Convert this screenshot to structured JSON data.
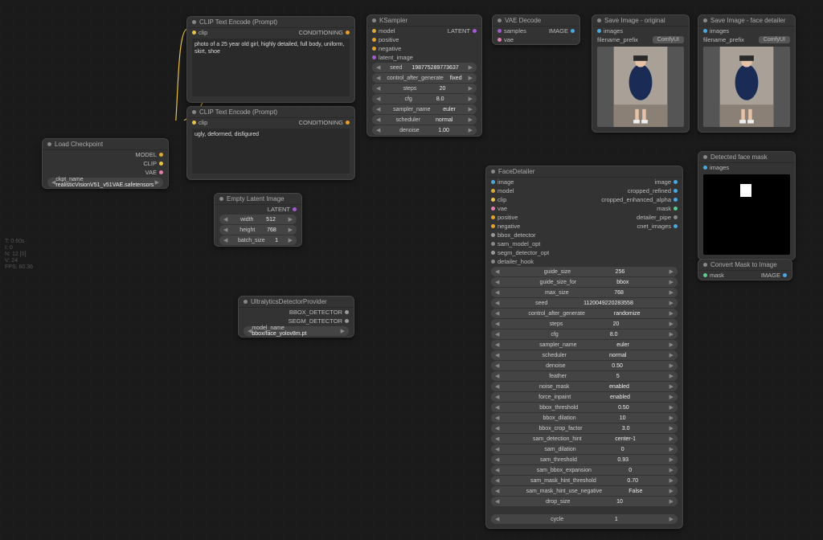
{
  "stats": {
    "l1": "T: 0.60s",
    "l2": "I: 0",
    "l3": "N: 12 [0]",
    "l4": "V: 24",
    "l5": "FPS: 60.36"
  },
  "load_ckpt": {
    "title": "Load Checkpoint",
    "out_model": "MODEL",
    "out_clip": "CLIP",
    "out_vae": "VAE",
    "ckpt_label": "ckpt_name",
    "ckpt_value": "realisticVisionV51_v51VAE.safetensors"
  },
  "clip_pos": {
    "title": "CLIP Text Encode (Prompt)",
    "in_clip": "clip",
    "out_cond": "CONDITIONING",
    "text": "photo of a 25 year old girl, highly detailed, full body, uniform, skirt, shoe"
  },
  "clip_neg": {
    "title": "CLIP Text Encode (Prompt)",
    "in_clip": "clip",
    "out_cond": "CONDITIONING",
    "text": "ugly, deformed, disfigured"
  },
  "empty": {
    "title": "Empty Latent Image",
    "out": "LATENT",
    "rows": [
      {
        "k": "width",
        "v": "512"
      },
      {
        "k": "height",
        "v": "768"
      },
      {
        "k": "batch_size",
        "v": "1"
      }
    ]
  },
  "ksampler": {
    "title": "KSampler",
    "ins": [
      "model",
      "positive",
      "negative",
      "latent_image"
    ],
    "out": "LATENT",
    "rows": [
      {
        "k": "seed",
        "v": "198775289773637"
      },
      {
        "k": "control_after_generate",
        "v": "fixed"
      },
      {
        "k": "steps",
        "v": "20"
      },
      {
        "k": "cfg",
        "v": "8.0"
      },
      {
        "k": "sampler_name",
        "v": "euler"
      },
      {
        "k": "scheduler",
        "v": "normal"
      },
      {
        "k": "denoise",
        "v": "1.00"
      }
    ]
  },
  "vae_dec": {
    "title": "VAE Decode",
    "in_samples": "samples",
    "in_vae": "vae",
    "out": "IMAGE"
  },
  "save_orig": {
    "title": "Save Image - original",
    "in": "images",
    "prefix_label": "filename_prefix",
    "prefix": "ComfyUI"
  },
  "save_face": {
    "title": "Save Image - face detailer",
    "in": "images",
    "prefix_label": "filename_prefix",
    "prefix": "ComfyUI"
  },
  "det_mask": {
    "title": "Detected face mask",
    "in": "images"
  },
  "conv_mask": {
    "title": "Convert Mask to Image",
    "in": "mask",
    "out": "IMAGE"
  },
  "ultra": {
    "title": "UltralyticsDetectorProvider",
    "out_bbox": "BBOX_DETECTOR",
    "out_segm": "SEGM_DETECTOR",
    "model_label": "model_name",
    "model": "bbox/face_yolov8m.pt"
  },
  "face": {
    "title": "FaceDetailer",
    "ins": [
      "image",
      "model",
      "clip",
      "vae",
      "positive",
      "negative",
      "bbox_detector",
      "sam_model_opt",
      "segm_detector_opt",
      "detailer_hook"
    ],
    "outs": [
      "image",
      "cropped_refined",
      "cropped_enhanced_alpha",
      "mask",
      "detailer_pipe",
      "cnet_images"
    ],
    "rows": [
      {
        "k": "guide_size",
        "v": "256"
      },
      {
        "k": "guide_size_for",
        "v": "bbox"
      },
      {
        "k": "max_size",
        "v": "768"
      },
      {
        "k": "seed",
        "v": "1120049220283558"
      },
      {
        "k": "control_after_generate",
        "v": "randomize"
      },
      {
        "k": "steps",
        "v": "20"
      },
      {
        "k": "cfg",
        "v": "8.0"
      },
      {
        "k": "sampler_name",
        "v": "euler"
      },
      {
        "k": "scheduler",
        "v": "normal"
      },
      {
        "k": "denoise",
        "v": "0.50"
      },
      {
        "k": "feather",
        "v": "5"
      },
      {
        "k": "noise_mask",
        "v": "enabled"
      },
      {
        "k": "force_inpaint",
        "v": "enabled"
      },
      {
        "k": "bbox_threshold",
        "v": "0.50"
      },
      {
        "k": "bbox_dilation",
        "v": "10"
      },
      {
        "k": "bbox_crop_factor",
        "v": "3.0"
      },
      {
        "k": "sam_detection_hint",
        "v": "center-1"
      },
      {
        "k": "sam_dilation",
        "v": "0"
      },
      {
        "k": "sam_threshold",
        "v": "0.93"
      },
      {
        "k": "sam_bbox_expansion",
        "v": "0"
      },
      {
        "k": "sam_mask_hint_threshold",
        "v": "0.70"
      },
      {
        "k": "sam_mask_hint_use_negative",
        "v": "False"
      },
      {
        "k": "drop_size",
        "v": "10"
      }
    ],
    "cycle": {
      "k": "cycle",
      "v": "1"
    }
  }
}
